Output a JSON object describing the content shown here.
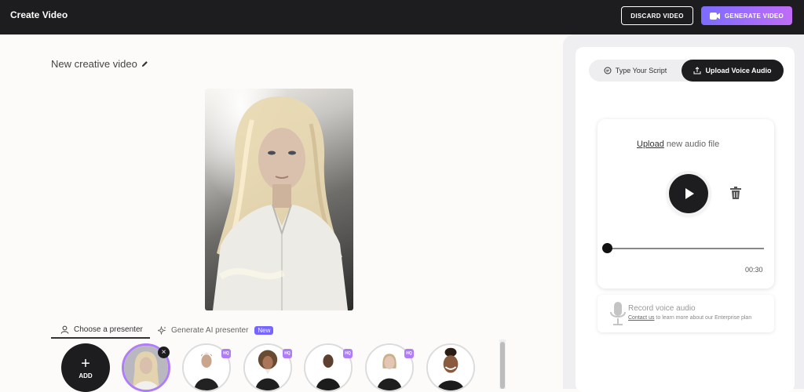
{
  "header": {
    "title": "Create Video",
    "discard_label": "DISCARD VIDEO",
    "generate_label": "GENERATE VIDEO"
  },
  "editor": {
    "video_title": "New creative video"
  },
  "presenter_tabs": {
    "choose_label": "Choose a presenter",
    "generate_ai_label": "Generate AI presenter",
    "new_badge": "New"
  },
  "presenters": {
    "add_label": "ADD",
    "add_icon": "+",
    "hq_badge": "HQ",
    "remove_icon": "×"
  },
  "panel": {
    "tabs": {
      "script_label": "Type Your Script",
      "upload_label": "Upload Voice Audio"
    },
    "audio": {
      "upload_link": "Upload",
      "upload_rest": " new audio file",
      "progress": 0,
      "duration": "00:30"
    },
    "record": {
      "title": "Record voice audio",
      "contact_link": "Contact us",
      "contact_rest": " to learn more about our Enterprise plan"
    }
  },
  "colors": {
    "accent_start": "#7b6cff",
    "accent_end": "#c06cf6",
    "dark": "#1d1d1f",
    "badge_purple": "#b07cf7"
  }
}
